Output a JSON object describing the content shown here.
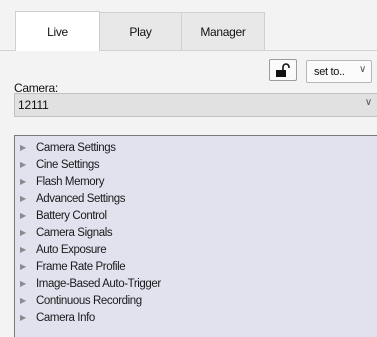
{
  "tabs": [
    {
      "label": "Live",
      "active": true
    },
    {
      "label": "Play",
      "active": false
    },
    {
      "label": "Manager",
      "active": false
    }
  ],
  "camera": {
    "label": "Camera:",
    "selected": "12111"
  },
  "toolbar": {
    "lock_icon": "unlock-icon",
    "set_to_label": "set to.."
  },
  "settings_tree": {
    "items": [
      {
        "label": "Camera Settings"
      },
      {
        "label": "Cine Settings"
      },
      {
        "label": "Flash Memory"
      },
      {
        "label": "Advanced Settings"
      },
      {
        "label": "Battery Control"
      },
      {
        "label": "Camera Signals"
      },
      {
        "label": "Auto Exposure"
      },
      {
        "label": "Frame Rate Profile"
      },
      {
        "label": "Image-Based Auto-Trigger"
      },
      {
        "label": "Continuous Recording"
      },
      {
        "label": "Camera Info"
      }
    ]
  }
}
